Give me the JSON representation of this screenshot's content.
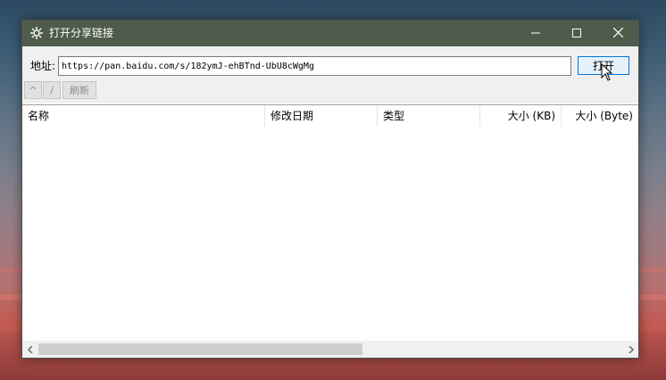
{
  "window": {
    "title": "打开分享链接",
    "title_icon": "gear-icon",
    "controls": {
      "minimize": "minimize-icon",
      "maximize": "maximize-icon",
      "close": "close-icon"
    }
  },
  "address": {
    "label": "地址:",
    "value": "https://pan.baidu.com/s/182ymJ-ehBTnd-UbU8cWgMg",
    "open_label": "打开"
  },
  "toolbar": {
    "up_label": "^",
    "path_label": "/",
    "refresh_label": "刷新"
  },
  "table": {
    "columns": [
      "名称",
      "修改日期",
      "类型",
      "大小 (KB)",
      "大小 (Byte)"
    ]
  },
  "colors": {
    "titlebar": "#4f5b4b",
    "accent": "#0078d7",
    "button_bg": "#e5f1fb"
  }
}
